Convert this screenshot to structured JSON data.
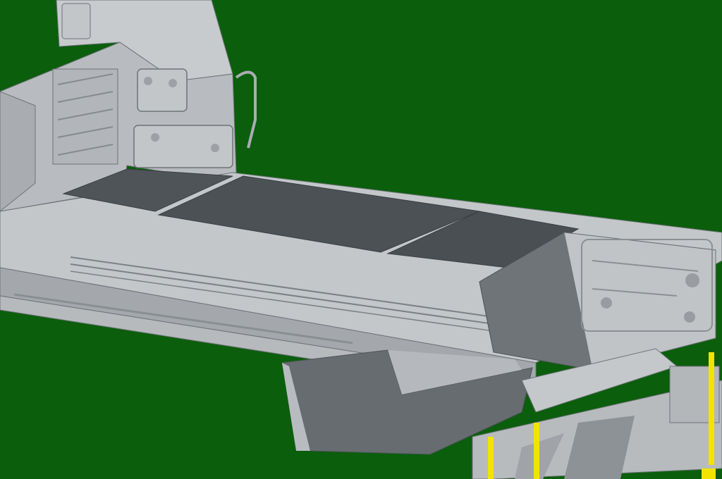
{
  "viewport": {
    "background_color": "#0b5e0c"
  },
  "model": {
    "base_color": "#b8bcc0",
    "light_color": "#cfd3d6",
    "shadow_color": "#8e9397",
    "dark_panel_color": "#4f5459",
    "accent_color": "#f2e300",
    "outline_color": "#6e7378"
  }
}
